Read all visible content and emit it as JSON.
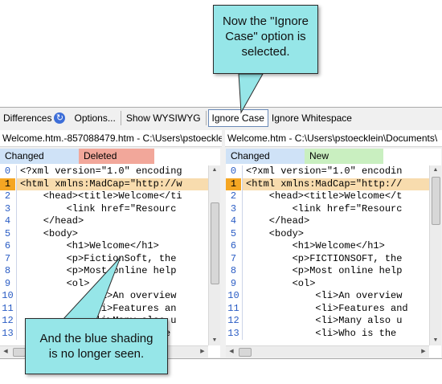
{
  "toolbar": {
    "differences": "Differences",
    "options": "Options...",
    "show_wysiwyg": "Show WYSIWYG",
    "ignore_case": "Ignore Case",
    "ignore_whitespace": "Ignore Whitespace"
  },
  "left_pane": {
    "path": "Welcome.htm.-857088479.htm - C:\\Users\\pstoecklein",
    "tabs": {
      "changed": "Changed",
      "deleted": "Deleted"
    },
    "lines": [
      {
        "num": "0",
        "text": "<?xml version=\"1.0\" encoding"
      },
      {
        "num": "1",
        "text": "<html xmlns:MadCap=\"http://w"
      },
      {
        "num": "2",
        "text": "    <head><title>Welcome</ti"
      },
      {
        "num": "3",
        "text": "        <link href=\"Resourc"
      },
      {
        "num": "4",
        "text": "    </head>"
      },
      {
        "num": "5",
        "text": "    <body>"
      },
      {
        "num": "6",
        "text": "        <h1>Welcome</h1>"
      },
      {
        "num": "7",
        "text": "        <p>FictionSoft, the"
      },
      {
        "num": "8",
        "text": "        <p>Most online help"
      },
      {
        "num": "9",
        "text": "        <ol>"
      },
      {
        "num": "10",
        "text": "            <li>An overview"
      },
      {
        "num": "11",
        "text": "            <li>Features an"
      },
      {
        "num": "12",
        "text": "            <li>Many also u"
      },
      {
        "num": "13",
        "text": "            <li>Who is the "
      }
    ]
  },
  "right_pane": {
    "path": "Welcome.htm - C:\\Users\\pstoecklein\\Documents\\",
    "tabs": {
      "changed": "Changed",
      "new": "New"
    },
    "lines": [
      {
        "num": "0",
        "text": "<?xml version=\"1.0\" encodin"
      },
      {
        "num": "1",
        "text": "<html xmlns:MadCap=\"http://"
      },
      {
        "num": "2",
        "text": "    <head><title>Welcome</t"
      },
      {
        "num": "3",
        "text": "        <link href=\"Resourc"
      },
      {
        "num": "4",
        "text": "    </head>"
      },
      {
        "num": "5",
        "text": "    <body>"
      },
      {
        "num": "6",
        "text": "        <h1>Welcome</h1>"
      },
      {
        "num": "7",
        "text": "        <p>FICTIONSOFT, the"
      },
      {
        "num": "8",
        "text": "        <p>Most online help"
      },
      {
        "num": "9",
        "text": "        <ol>"
      },
      {
        "num": "10",
        "text": "            <li>An overview"
      },
      {
        "num": "11",
        "text": "            <li>Features and"
      },
      {
        "num": "12",
        "text": "            <li>Many also u"
      },
      {
        "num": "13",
        "text": "            <li>Who is the "
      }
    ]
  },
  "callouts": {
    "top": [
      "Now the \"Ignore",
      "Case\" option is",
      "selected."
    ],
    "bottom": [
      "And the blue shading",
      "is no longer seen."
    ]
  },
  "colors": {
    "changed_tab": "#cfe2f7",
    "deleted_tab": "#f2a79a",
    "new_tab": "#c9efc0",
    "highlight_line_number": "#f5a623",
    "highlight_line": "#f8dcae",
    "callout_fill": "#96e6e8"
  }
}
